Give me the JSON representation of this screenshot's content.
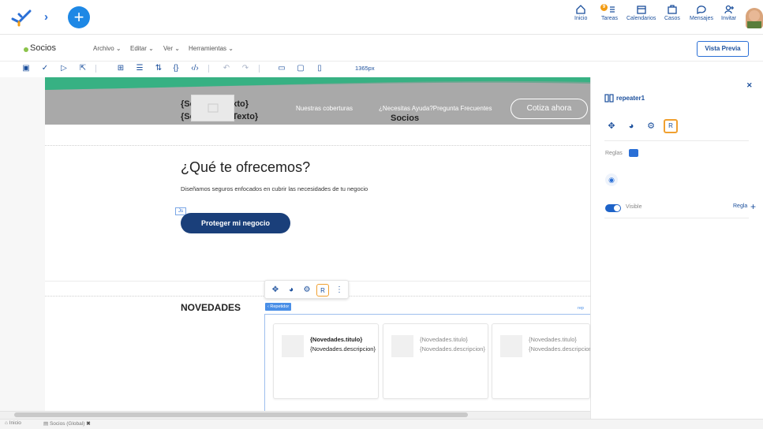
{
  "topbar": {
    "nav": [
      {
        "label": "Inicio",
        "icon": "home-icon"
      },
      {
        "label": "Tareas",
        "icon": "tasks-icon",
        "badge": "9"
      },
      {
        "label": "Calendarios",
        "icon": "calendar-icon"
      },
      {
        "label": "Casos",
        "icon": "briefcase-icon"
      },
      {
        "label": "Mensajes",
        "icon": "chat-icon"
      },
      {
        "label": "Invitar",
        "icon": "invite-user-icon"
      }
    ]
  },
  "app": {
    "title": "Socios",
    "menus": [
      "Archivo",
      "Editar",
      "Ver",
      "Herramientas"
    ],
    "preview_label": "Vista Previa",
    "viewport_label": "1365px"
  },
  "hero": {
    "text1": "{SoPrimerTexto}",
    "text2": "{SoSegundoTexto}",
    "link1": "Nuestras coberturas",
    "link2": "¿Necesitas Ayuda?Pregunta Frecuentes",
    "cta": "Cotiza ahora",
    "center_title": "Socios"
  },
  "offer": {
    "title": "¿Qué te ofrecemos?",
    "subtitle": "Diseñamos seguros enfocados en cubrir las necesidades de tu negocio",
    "js_tag": "Js",
    "button": "Proteger mi negocio"
  },
  "news": {
    "title": "NOVEDADES",
    "repeater_tag": "‹ Repetidor",
    "repeater_right": "rep",
    "cards": [
      {
        "title": "{Novedades.titulo}",
        "desc": "{Novedades.descripcion}"
      },
      {
        "title": "{Novedades.titulo}",
        "desc": "{Novedades.descripcion}"
      },
      {
        "title": "{Novedades.titulo}",
        "desc": "{Novedades.descripcion}"
      }
    ]
  },
  "panel": {
    "title": "repeater1",
    "rules_label": "Reglas",
    "visible_label": "Visible",
    "rule_label": "Regla"
  },
  "bottom": {
    "tab1": "Inicio",
    "tab2": "Socios (Global)"
  },
  "colors": {
    "accent": "#1e88e5",
    "brand_dark": "#1a3f7a",
    "active_outline": "#f0a030",
    "hero_gray": "#a9a9a9",
    "green": "#3ebd8c"
  }
}
